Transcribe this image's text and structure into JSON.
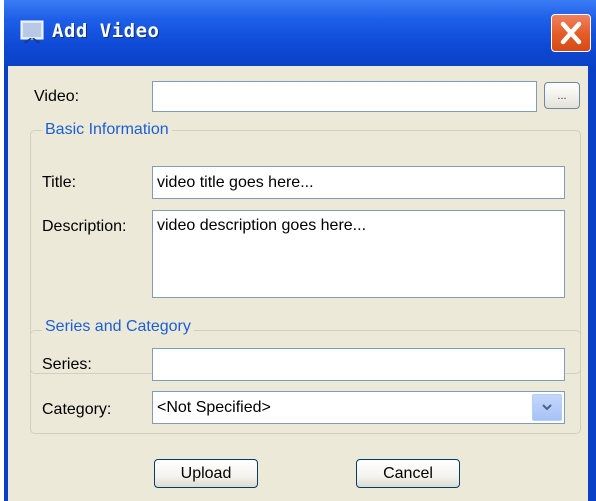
{
  "window": {
    "title": "Add Video",
    "close_symbol": "✕"
  },
  "video": {
    "label": "Video:",
    "value": "",
    "browse_label": "..."
  },
  "basic_info": {
    "legend": "Basic Information",
    "title_label": "Title:",
    "title_value": "video title goes here...",
    "description_label": "Description:",
    "description_value": "video description goes here..."
  },
  "series_category": {
    "legend": "Series and Category",
    "series_label": "Series:",
    "series_value": "",
    "category_label": "Category:",
    "category_value": "<Not Specified>"
  },
  "buttons": {
    "upload": "Upload",
    "cancel": "Cancel"
  },
  "icons": {
    "title": "video-window-icon",
    "close": "close-icon",
    "dropdown": "chevron-down-icon"
  }
}
